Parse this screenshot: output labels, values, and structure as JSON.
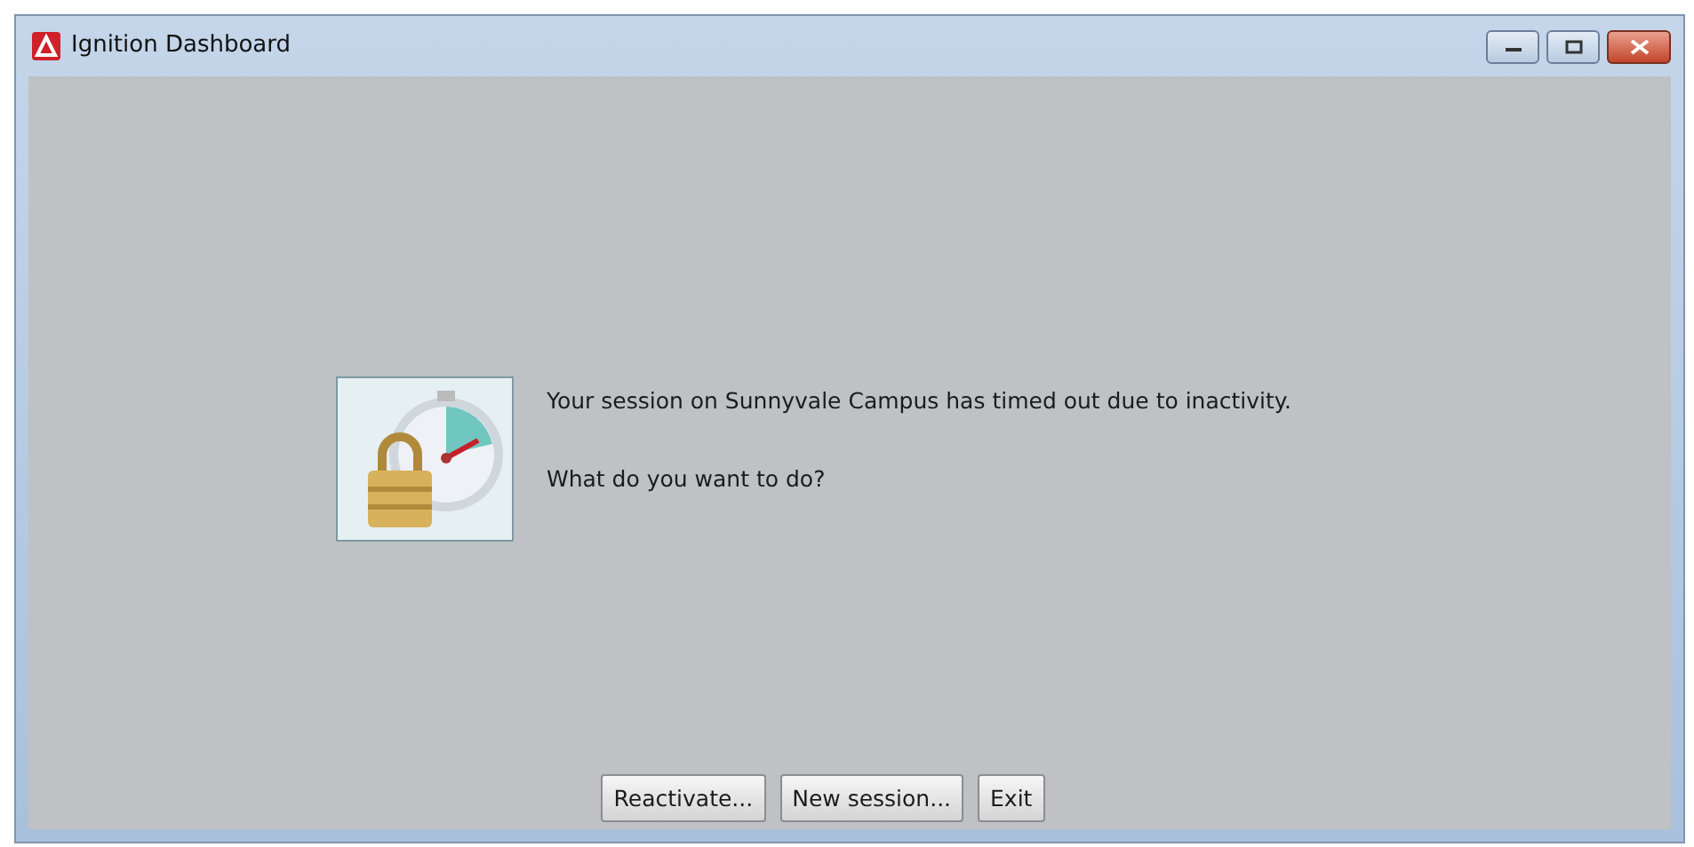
{
  "window": {
    "title": "Ignition Dashboard",
    "controls": [
      {
        "kind": "minimize"
      },
      {
        "kind": "maximize"
      },
      {
        "kind": "close"
      }
    ]
  },
  "message": {
    "lines": [
      "Your session on Sunnyvale Campus has timed out due to inactivity.",
      "What do you want to do?"
    ]
  },
  "buttons": [
    "Reactivate...",
    "New session...",
    "Exit"
  ]
}
